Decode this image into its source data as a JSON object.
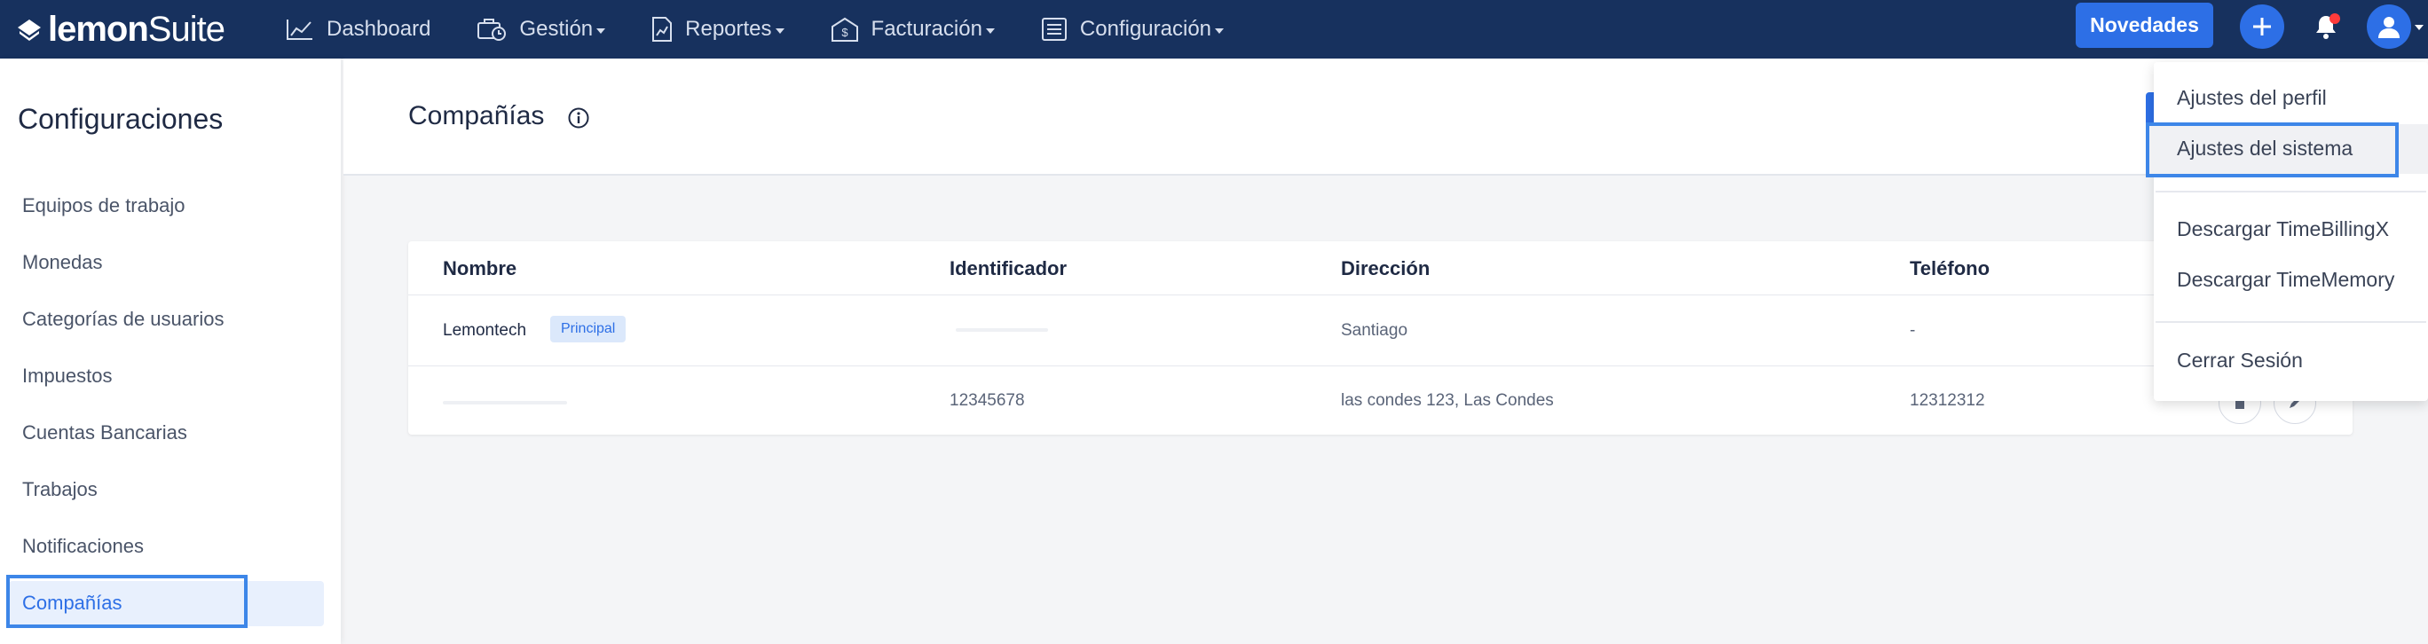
{
  "brand": {
    "bold": "lemon",
    "light": "Suite"
  },
  "nav": {
    "items": [
      {
        "label": "Dashboard",
        "icon": "chart-line-icon",
        "caret": false
      },
      {
        "label": "Gestión",
        "icon": "briefcase-clock-icon",
        "caret": true
      },
      {
        "label": "Reportes",
        "icon": "report-chart-icon",
        "caret": true
      },
      {
        "label": "Facturación",
        "icon": "invoice-icon",
        "caret": true
      },
      {
        "label": "Configuración",
        "icon": "list-settings-icon",
        "caret": true
      }
    ],
    "novedades_label": "Novedades"
  },
  "sidebar": {
    "title": "Configuraciones",
    "items": [
      {
        "label": "Equipos de trabajo"
      },
      {
        "label": "Monedas"
      },
      {
        "label": "Categorías de usuarios"
      },
      {
        "label": "Impuestos"
      },
      {
        "label": "Cuentas Bancarias"
      },
      {
        "label": "Trabajos"
      },
      {
        "label": "Notificaciones"
      },
      {
        "label": "Compañías",
        "active": true
      }
    ]
  },
  "main": {
    "title": "Compañías",
    "table": {
      "headers": [
        "Nombre",
        "Identificador",
        "Dirección",
        "Teléfono"
      ],
      "rows": [
        {
          "nombre": "Lemontech",
          "badge": "Principal",
          "identificador": "",
          "direccion": "Santiago",
          "telefono": "-"
        },
        {
          "nombre": "",
          "identificador": "12345678",
          "direccion": "las condes 123, Las Condes",
          "telefono": "12312312"
        }
      ]
    }
  },
  "dropdown": {
    "items": [
      "Ajustes del perfil",
      "Ajustes del sistema",
      "Descargar TimeBillingX",
      "Descargar TimeMemory",
      "Cerrar Sesión"
    ]
  },
  "colors": {
    "nav_bg": "#17315e",
    "accent": "#2d6fe6",
    "highlight_frame": "#3d86e8",
    "notification_dot": "#ff3b3b"
  }
}
